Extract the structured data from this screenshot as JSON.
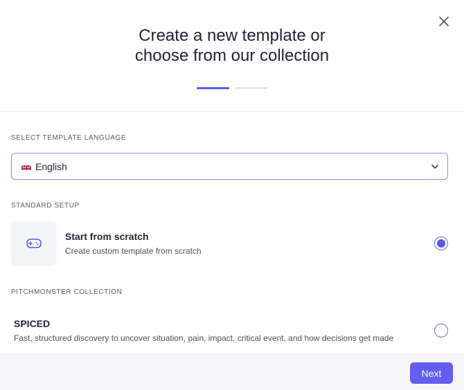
{
  "header": {
    "title_line1": "Create a new template or",
    "title_line2": "choose from our collection",
    "close_icon": "close-icon",
    "steps": [
      {
        "active": true
      },
      {
        "active": false
      }
    ]
  },
  "language": {
    "section_label": "SELECT TEMPLATE LANGUAGE",
    "flag_icon": "uk-flag-icon",
    "selected": "English"
  },
  "standard_setup": {
    "section_label": "STANDARD SETUP",
    "scratch": {
      "icon": "gamepad-icon",
      "title": "Start from scratch",
      "description": "Create custom template from scratch",
      "selected": true
    }
  },
  "collection": {
    "section_label": "PITCHMONSTER COLLECTION",
    "items": [
      {
        "title": "SPICED",
        "description": "Fast, structured discovery to uncover situation, pain, impact, critical event, and how decisions get made",
        "selected": false
      }
    ]
  },
  "footer": {
    "next_label": "Next"
  },
  "colors": {
    "accent": "#5b58e8",
    "select_border": "#8f8cf0",
    "muted_text": "#535968"
  }
}
